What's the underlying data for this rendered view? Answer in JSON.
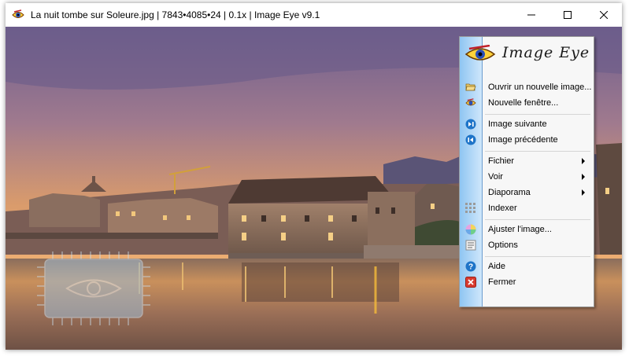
{
  "window": {
    "title": "La nuit tombe sur Soleure.jpg | 7843•4085•24 | 0.1x | Image Eye v9.1",
    "app_icon": "eye-icon",
    "caption_buttons": [
      "minimize-icon",
      "maximize-icon",
      "close-icon"
    ]
  },
  "menu": {
    "brand": "Image Eye",
    "items": [
      {
        "label": "Ouvrir un nouvelle image...",
        "icon": "folder-open-icon"
      },
      {
        "label": "Nouvelle fenêtre...",
        "icon": "eye-icon"
      },
      {
        "label": "Image suivante",
        "icon": "next-icon"
      },
      {
        "label": "Image précédente",
        "icon": "previous-icon"
      },
      {
        "label": "Fichier",
        "submenu": true
      },
      {
        "label": "Voir",
        "submenu": true
      },
      {
        "label": "Diaporama",
        "submenu": true
      },
      {
        "label": "Indexer",
        "icon": "grid-icon"
      },
      {
        "label": "Ajuster l'image...",
        "icon": "color-wheel-icon"
      },
      {
        "label": "Options",
        "icon": "options-icon"
      },
      {
        "label": "Aide",
        "icon": "help-icon"
      },
      {
        "label": "Fermer",
        "icon": "close-icon"
      }
    ]
  },
  "colors": {
    "menu_strip": "#8fc5f2",
    "help_blue": "#1e74c8",
    "close_red": "#d83a2e"
  }
}
